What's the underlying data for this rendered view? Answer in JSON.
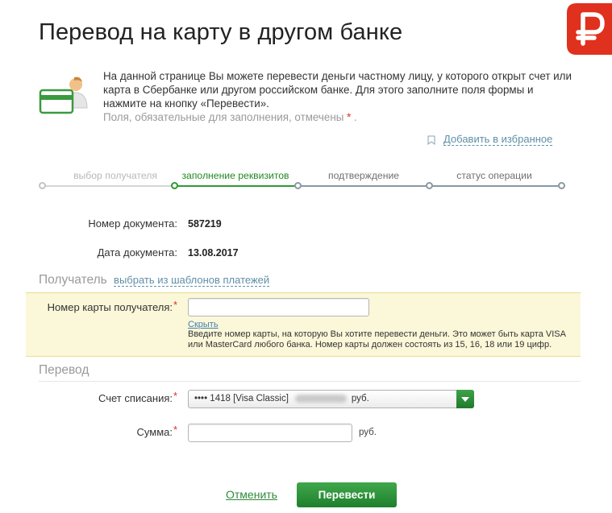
{
  "page": {
    "title": "Перевод на карту в другом банке"
  },
  "intro": {
    "text": "На данной странице Вы можете перевести деньги частному лицу, у которого открыт счет или карта в Сбербанке или другом российском банке. Для этого заполните поля формы и нажмите на кнопку «Перевести».",
    "required_note": "Поля, обязательные для заполнения, отмечены",
    "required_star": "*",
    "required_end": "."
  },
  "favorites": {
    "label": "Добавить в избранное"
  },
  "steps": [
    {
      "label": "выбор получателя",
      "state": "past"
    },
    {
      "label": "заполнение реквизитов",
      "state": "active"
    },
    {
      "label": "подтверждение",
      "state": "future"
    },
    {
      "label": "статус операции",
      "state": "future"
    }
  ],
  "document": {
    "number_label": "Номер документа:",
    "number_value": "587219",
    "date_label": "Дата документа:",
    "date_value": "13.08.2017"
  },
  "recipient": {
    "section_title": "Получатель",
    "template_link": "выбрать из шаблонов платежей",
    "card_label": "Номер карты получателя:",
    "required_star": "*",
    "card_value": "",
    "hide_link": "Скрыть",
    "hint": "Введите номер карты, на которую Вы хотите перевести деньги. Это может быть карта VISA или MasterCard любого банка. Номер карты должен состоять из 15, 16, 18 или 19 цифр."
  },
  "transfer": {
    "section_title": "Перевод",
    "account_label": "Счет списания:",
    "required_star": "*",
    "account_value": "•••• 1418  [Visa Classic]",
    "account_currency": "руб.",
    "amount_label": "Сумма:",
    "amount_value": "",
    "amount_currency": "руб."
  },
  "actions": {
    "cancel": "Отменить",
    "submit": "Перевести"
  },
  "colors": {
    "accent_green": "#2e9a36",
    "link_blue": "#5f8fa8",
    "highlight_yellow": "#fbf7d9",
    "logo_red": "#e0301e"
  }
}
